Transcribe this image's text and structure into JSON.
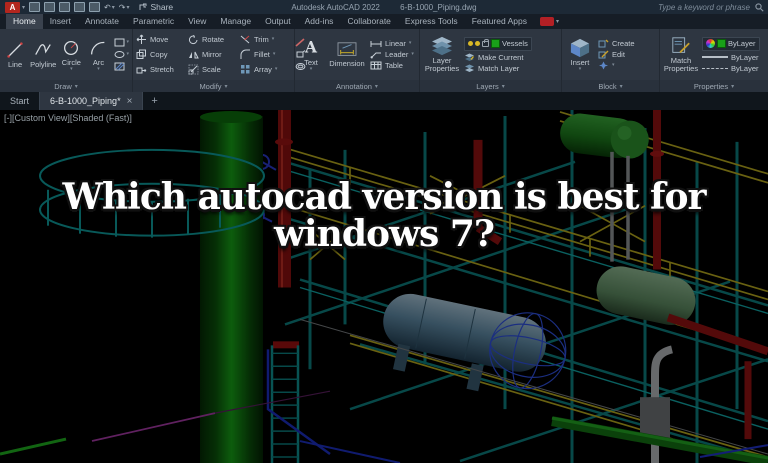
{
  "ui": {
    "caret": "▾",
    "undo": "↶",
    "redo": "↷"
  },
  "titlebar": {
    "logo": "A",
    "share": "Share",
    "app_title": "Autodesk AutoCAD 2022",
    "doc_title": "6-B-1000_Piping.dwg",
    "search_placeholder": "Type a keyword or phrase",
    "qat_icons": [
      "new-file",
      "open-folder",
      "save",
      "save-as",
      "plot",
      "undo",
      "redo"
    ]
  },
  "ribbon_tabs": [
    "Home",
    "Insert",
    "Annotate",
    "Parametric",
    "View",
    "Manage",
    "Output",
    "Add-ins",
    "Collaborate",
    "Express Tools",
    "Featured Apps"
  ],
  "draw": {
    "label": "Draw",
    "line": "Line",
    "polyline": "Polyline",
    "circle": "Circle",
    "arc": "Arc"
  },
  "modify": {
    "label": "Modify",
    "tools": [
      "Move",
      "Copy",
      "Stretch",
      "Rotate",
      "Mirror",
      "Scale",
      "Trim",
      "Fillet",
      "Array"
    ]
  },
  "annotation": {
    "label": "Annotation",
    "text": "Text",
    "dimension": "Dimension",
    "linear": "Linear",
    "leader": "Leader",
    "table": "Table"
  },
  "layers": {
    "label": "Layers",
    "layer_properties": "Layer Properties",
    "current_layer": "Vessels",
    "make_current": "Make Current",
    "match_layer": "Match Layer"
  },
  "block": {
    "label": "Block",
    "insert": "Insert",
    "create": "Create",
    "edit": "Edit"
  },
  "properties": {
    "label": "Properties",
    "match_properties": "Match Properties",
    "color_value": "ByLayer",
    "lineweight_value": "ByLayer",
    "linetype_value": "ByLayer",
    "accent_green": "#19a019"
  },
  "file_tabs": {
    "start": "Start",
    "drawing": "6-B-1000_Piping*",
    "close": "×",
    "new_tab": "+"
  },
  "viewport": {
    "vp_control_min": "[-]",
    "vp_control_view": "[Custom View]",
    "vp_control_shade": "[Shaded (Fast)]",
    "headline_line1": "Which autocad version is best for",
    "headline_line2": "windows 7?"
  }
}
